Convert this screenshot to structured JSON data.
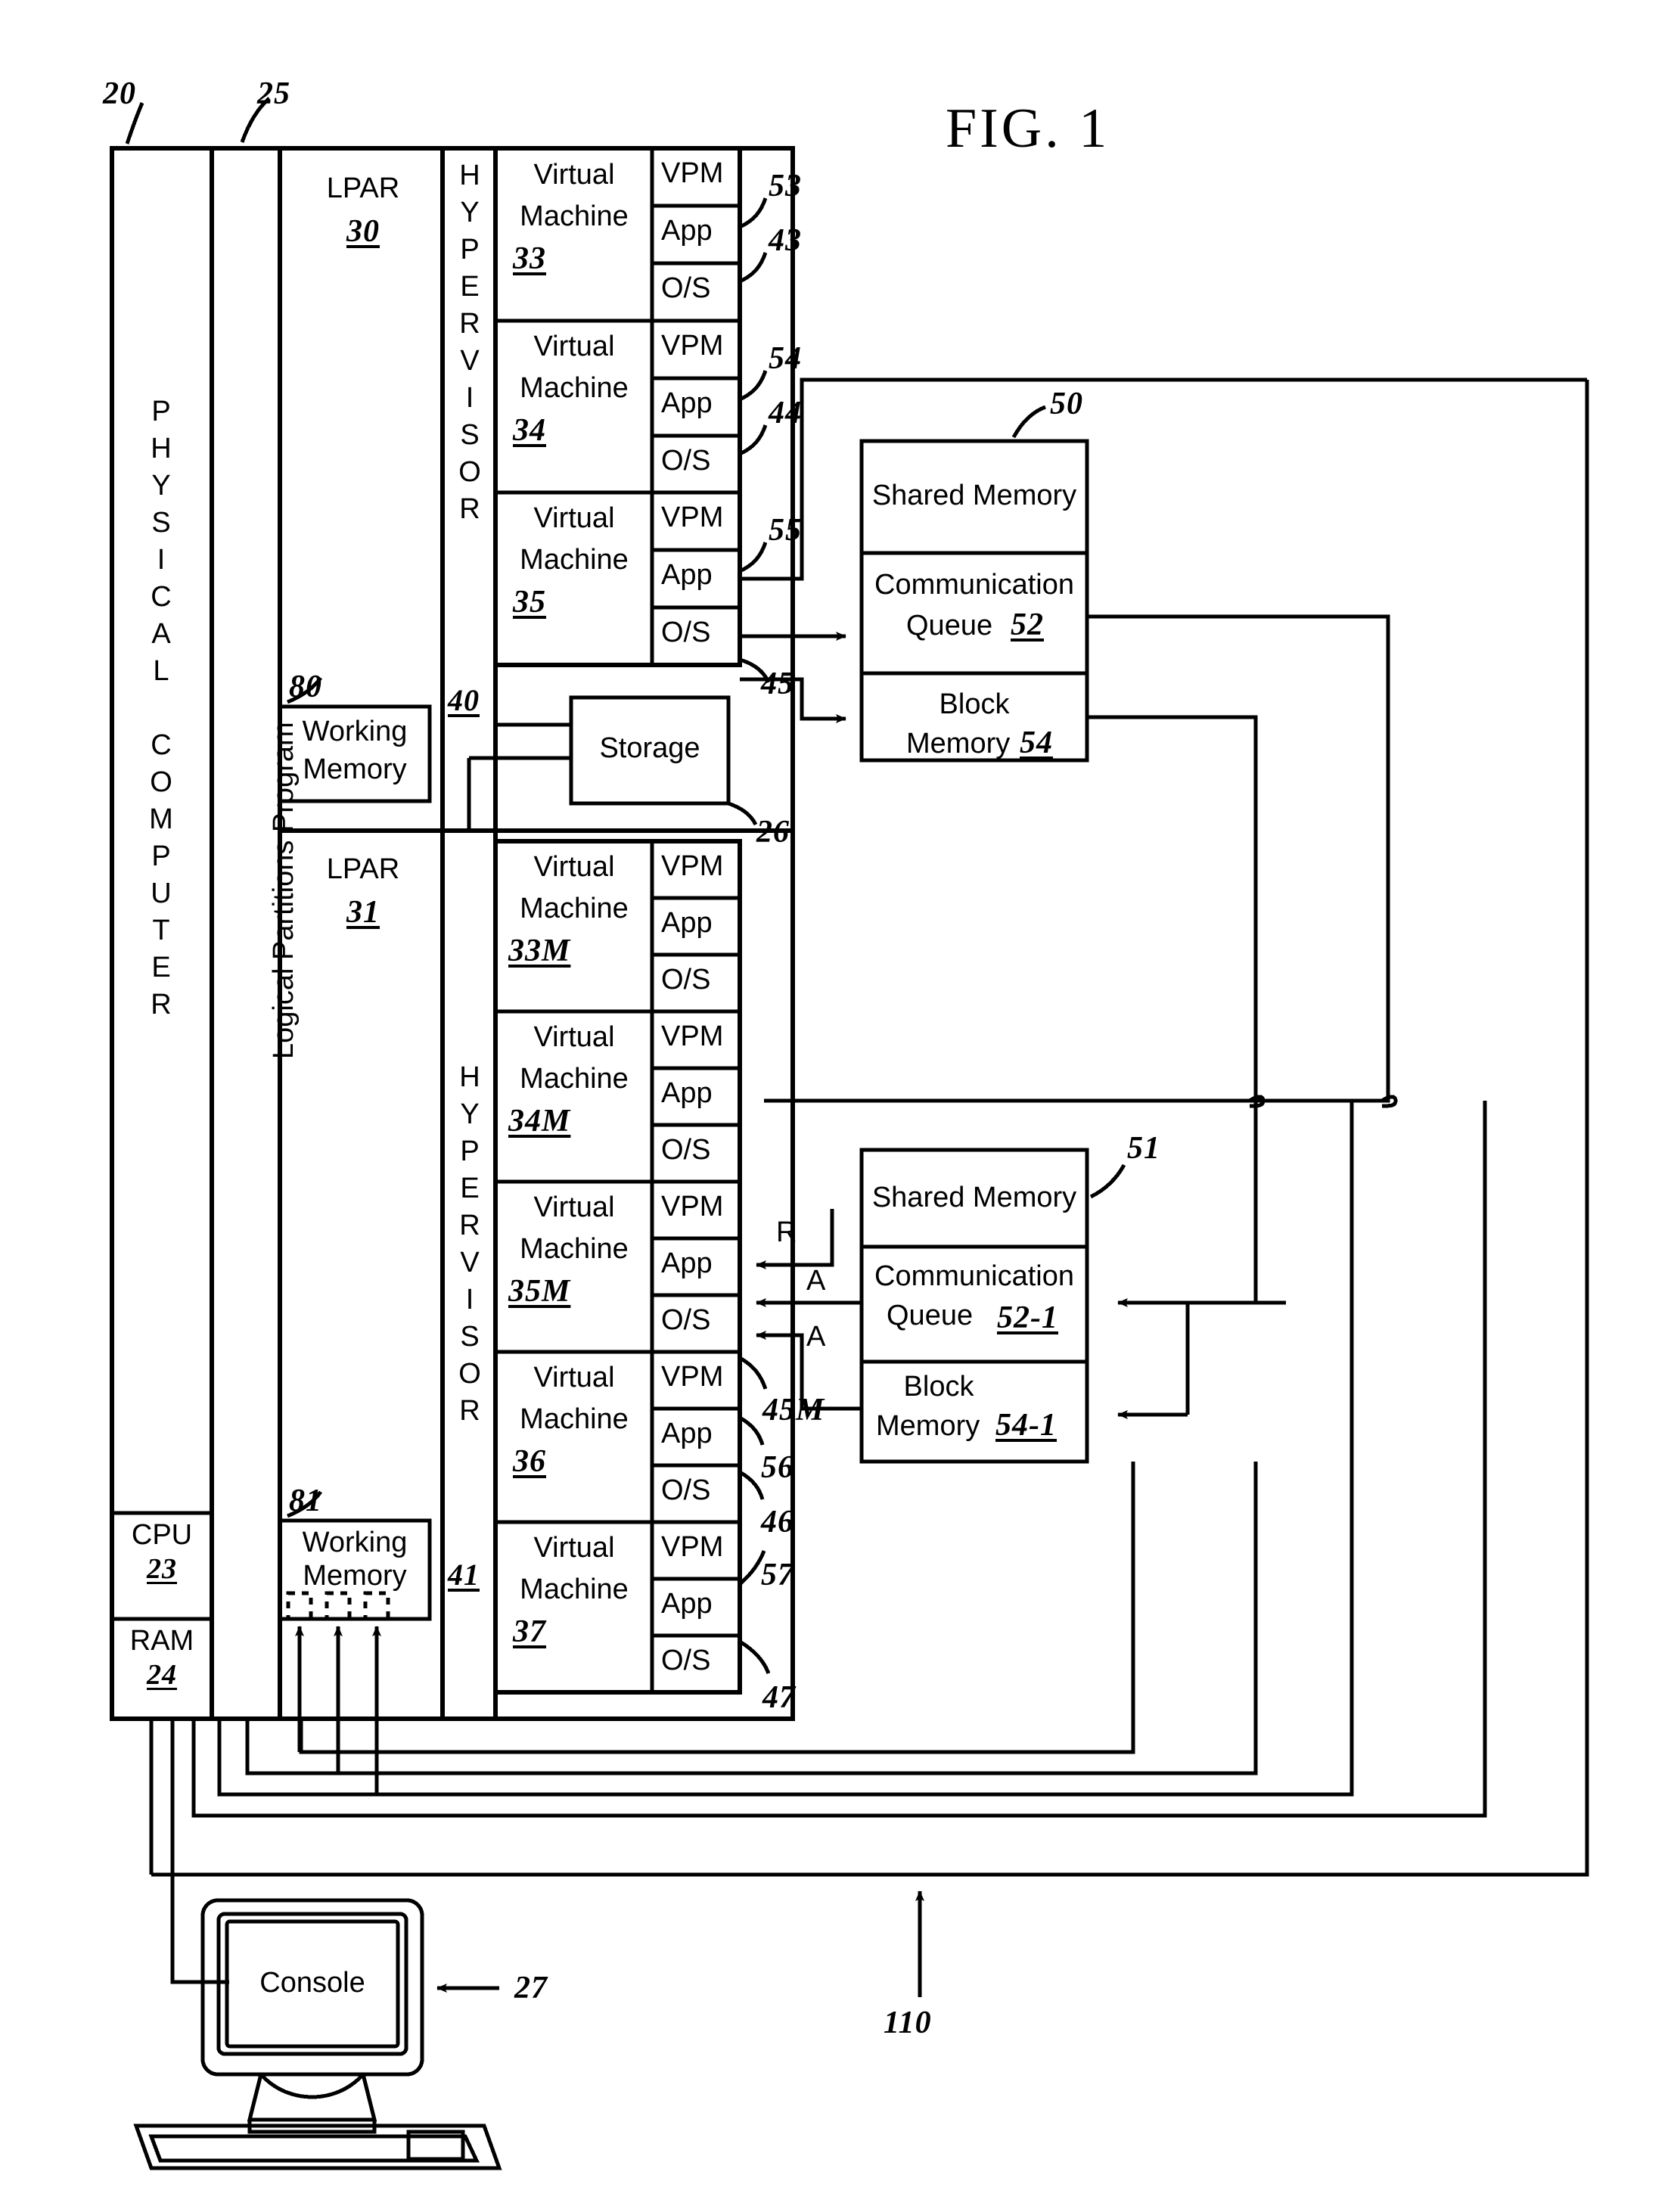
{
  "figure": {
    "title": "FIG.  1",
    "bottom_ref": "110"
  },
  "physical_computer": {
    "label_letters": [
      "P",
      "H",
      "Y",
      "S",
      "I",
      "C",
      "A",
      "L",
      "",
      "C",
      "O",
      "M",
      "P",
      "U",
      "T",
      "E",
      "R"
    ],
    "label_text": "PHYSICAL COMPUTER",
    "ref": "20",
    "cpu": {
      "name": "CPU",
      "ref": "23"
    },
    "ram": {
      "name": "RAM",
      "ref": "24"
    }
  },
  "lpar_program": {
    "label": "Logical Partitions Program",
    "ref": "25"
  },
  "lpars": [
    {
      "name": "LPAR",
      "ref": "30",
      "hypervisor": {
        "letters": [
          "H",
          "Y",
          "P",
          "E",
          "R",
          "V",
          "I",
          "S",
          "O",
          "R"
        ],
        "label": "HYPERVISOR",
        "ref": "40"
      },
      "working_memory": {
        "label_line1": "Working",
        "label_line2": "Memory",
        "ref": "80"
      },
      "vms": [
        {
          "name_line1": "Virtual",
          "name_line2": "Machine",
          "ref": "33",
          "rows": [
            "VPM",
            "App",
            "O/S"
          ],
          "ref_vpm": "53",
          "ref_os": "43"
        },
        {
          "name_line1": "Virtual",
          "name_line2": "Machine",
          "ref": "34",
          "rows": [
            "VPM",
            "App",
            "O/S"
          ],
          "ref_vpm": "54",
          "ref_os": "44"
        },
        {
          "name_line1": "Virtual",
          "name_line2": "Machine",
          "ref": "35",
          "rows": [
            "VPM",
            "App",
            "O/S"
          ],
          "ref_vpm": "55",
          "ref_os": "45"
        }
      ]
    },
    {
      "name": "LPAR",
      "ref": "31",
      "hypervisor": {
        "letters": [
          "H",
          "Y",
          "P",
          "E",
          "R",
          "V",
          "I",
          "S",
          "O",
          "R"
        ],
        "label": "HYPERVISOR",
        "ref": "41"
      },
      "working_memory": {
        "label_line1": "Working",
        "label_line2": "Memory",
        "ref": "81"
      },
      "vms": [
        {
          "name_line1": "Virtual",
          "name_line2": "Machine",
          "ref": "33M",
          "rows": [
            "VPM",
            "App",
            "O/S"
          ],
          "ref_vpm": "",
          "ref_os": ""
        },
        {
          "name_line1": "Virtual",
          "name_line2": "Machine",
          "ref": "34M",
          "rows": [
            "VPM",
            "App",
            "O/S"
          ],
          "ref_vpm": "",
          "ref_os": ""
        },
        {
          "name_line1": "Virtual",
          "name_line2": "Machine",
          "ref": "35M",
          "rows": [
            "VPM",
            "App",
            "O/S"
          ],
          "ref_vpm": "",
          "ref_os": "45M"
        },
        {
          "name_line1": "Virtual",
          "name_line2": "Machine",
          "ref": "36",
          "rows": [
            "VPM",
            "App",
            "O/S"
          ],
          "ref_vpm": "56",
          "ref_os": "46"
        },
        {
          "name_line1": "Virtual",
          "name_line2": "Machine",
          "ref": "37",
          "rows": [
            "VPM",
            "App",
            "O/S"
          ],
          "ref_vpm": "57",
          "ref_os": "47"
        }
      ]
    }
  ],
  "storage": {
    "label": "Storage",
    "ref": "26"
  },
  "shared_memories": [
    {
      "ref": "50",
      "title": "Shared Memory",
      "queue_line1": "Communication",
      "queue_line2": "Queue",
      "queue_ref": "52",
      "block_line1": "Block",
      "block_line2": "Memory",
      "block_ref": "54"
    },
    {
      "ref": "51",
      "title": "Shared Memory",
      "queue_line1": "Communication",
      "queue_line2": "Queue",
      "queue_ref": "52-1",
      "block_line1": "Block",
      "block_line2": "Memory",
      "block_ref": "54-1"
    }
  ],
  "arrow_labels": {
    "r": "R",
    "a1": "A",
    "a2": "A"
  },
  "console": {
    "label": "Console",
    "ref": "27"
  }
}
